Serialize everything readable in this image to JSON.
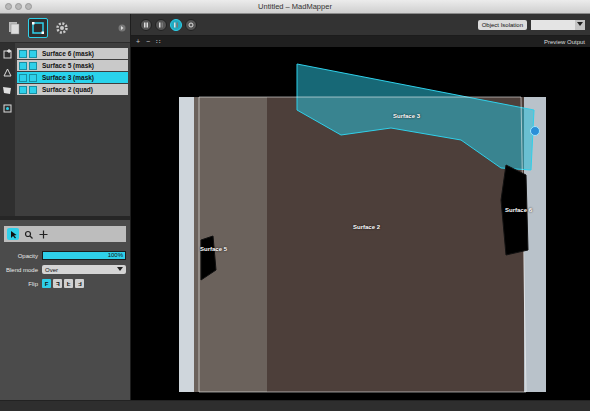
{
  "window": {
    "title": "Untitled – MadMapper"
  },
  "sidebar_tabs": [
    {
      "kind": "media",
      "selected": false
    },
    {
      "kind": "surfaces",
      "selected": true
    },
    {
      "kind": "settings",
      "selected": false
    }
  ],
  "surface_tools": [
    {
      "kind": "add-quad"
    },
    {
      "kind": "add-triangle"
    },
    {
      "kind": "add-mask"
    },
    {
      "kind": "add-circle"
    }
  ],
  "surfaces": [
    {
      "label": "Surface 6 (mask)",
      "selected": false,
      "visible": true,
      "solo": true
    },
    {
      "label": "Surface 5 (mask)",
      "selected": false,
      "visible": true,
      "solo": true
    },
    {
      "label": "Surface 3 (mask)",
      "selected": true,
      "visible": true,
      "solo": true
    },
    {
      "label": "Surface 2 (quad)",
      "selected": false,
      "visible": true,
      "solo": true
    }
  ],
  "edit_tools": [
    {
      "kind": "select",
      "selected": true
    },
    {
      "kind": "zoom",
      "selected": false
    },
    {
      "kind": "move",
      "selected": false
    }
  ],
  "properties": {
    "opacity": {
      "label": "Opacity",
      "level": 1,
      "reading": "100%"
    },
    "blend_mode": {
      "label": "Blend mode",
      "value": "Over"
    },
    "flip": {
      "label": "Flip",
      "buttons": [
        {
          "label": "F",
          "kind": "none",
          "selected": true
        },
        {
          "label": "F",
          "kind": "h",
          "selected": false
        },
        {
          "label": "F",
          "kind": "v",
          "selected": false
        },
        {
          "label": "F",
          "kind": "hv",
          "selected": false
        }
      ]
    }
  },
  "toolbar": {
    "view_modes": [
      {
        "kind": "split",
        "selected": false
      },
      {
        "kind": "input",
        "selected": false
      },
      {
        "kind": "output",
        "selected": true
      },
      {
        "kind": "preview",
        "selected": false
      }
    ],
    "object_isolation": {
      "label": "Object Isolation"
    }
  },
  "canvas_controls": [
    "+",
    "−",
    "∷"
  ],
  "preview_label": "Preview Output",
  "canvas": {
    "surfaces": [
      {
        "label": "Surface 3",
        "kind": "mask",
        "selected": true
      },
      {
        "label": "Surface 2",
        "kind": "quad",
        "selected": false
      },
      {
        "label": "Surface 6",
        "kind": "mask",
        "selected": false
      },
      {
        "label": "Surface 5",
        "kind": "mask",
        "selected": false
      }
    ]
  }
}
